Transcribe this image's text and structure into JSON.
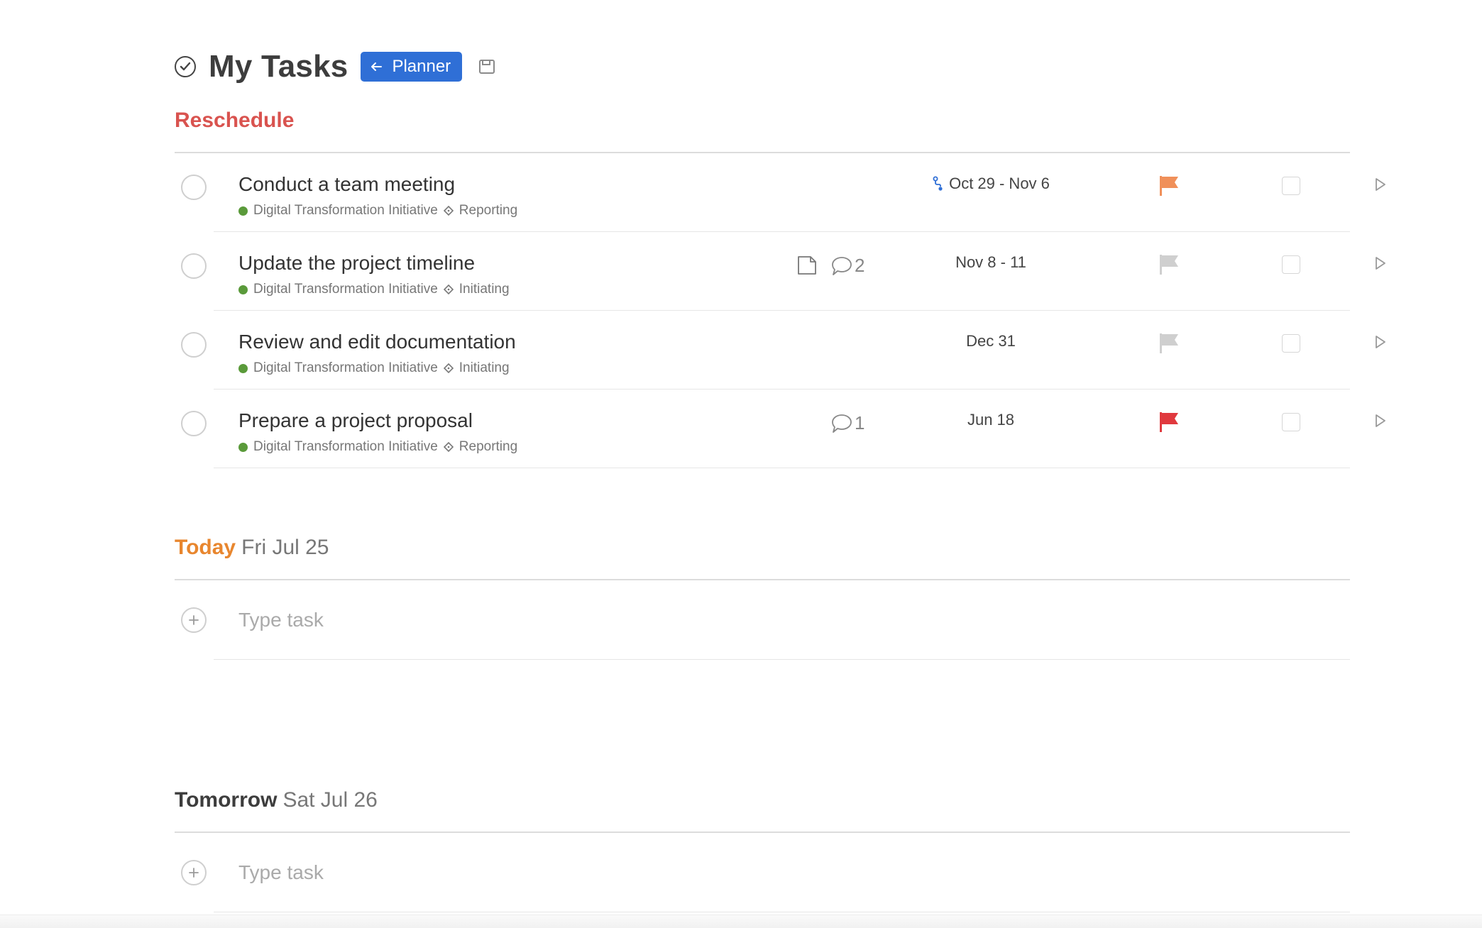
{
  "header": {
    "title": "My Tasks",
    "planner_label": "Planner"
  },
  "sections": {
    "reschedule": {
      "label": "Reschedule",
      "tasks": [
        {
          "name": "Conduct a team meeting",
          "project": "Digital Transformation Initiative",
          "phase": "Reporting",
          "date": "Oct 29 - Nov 6",
          "has_dependency": true,
          "flag_color": "#f0905a"
        },
        {
          "name": "Update the project timeline",
          "project": "Digital Transformation Initiative",
          "phase": "Initiating",
          "date": "Nov 8 - 11",
          "has_note": true,
          "comments": "2",
          "flag_color": "#cfcfcf"
        },
        {
          "name": "Review and edit documentation",
          "project": "Digital Transformation Initiative",
          "phase": "Initiating",
          "date": "Dec 31",
          "flag_color": "#cfcfcf"
        },
        {
          "name": "Prepare a project proposal",
          "project": "Digital Transformation Initiative",
          "phase": "Reporting",
          "date": "Jun 18",
          "comments": "1",
          "flag_color": "#e0393e"
        }
      ]
    },
    "today": {
      "label": "Today",
      "date": "Fri Jul 25",
      "input_placeholder": "Type task"
    },
    "tomorrow": {
      "label": "Tomorrow",
      "date": "Sat Jul 26",
      "input_placeholder": "Type task"
    }
  },
  "colors": {
    "planner_button": "#2f6fd6",
    "reschedule_label": "#d9534f",
    "today_label": "#e8862e",
    "project_dot": "#5a9a3a",
    "dependency_icon": "#2f6fd6"
  }
}
